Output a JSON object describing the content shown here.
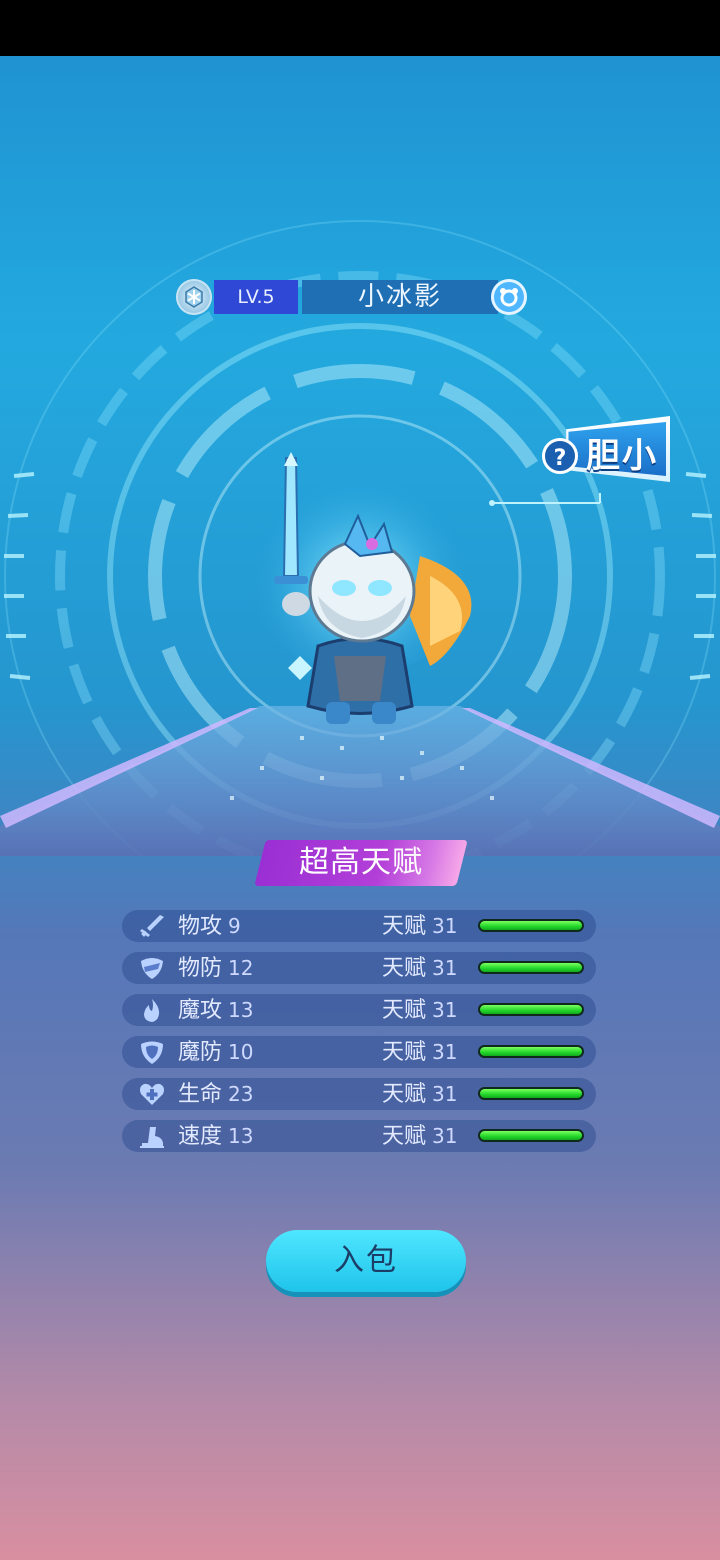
{
  "monster": {
    "level": "LV.5",
    "name": "小冰影",
    "element_icon": "ice-element-icon",
    "gender_icon": "gender-icon"
  },
  "trait": {
    "help_glyph": "?",
    "label": "胆小"
  },
  "talent_banner": "超高天赋",
  "stats": [
    {
      "icon": "sword-icon",
      "name": "物攻",
      "value": "9",
      "talent_label": "天赋",
      "talent_value": "31",
      "talent_fill": 1.0
    },
    {
      "icon": "shield-icon",
      "name": "物防",
      "value": "12",
      "talent_label": "天赋",
      "talent_value": "31",
      "talent_fill": 1.0
    },
    {
      "icon": "flame-icon",
      "name": "魔攻",
      "value": "13",
      "talent_label": "天赋",
      "talent_value": "31",
      "talent_fill": 1.0
    },
    {
      "icon": "magic-shield-icon",
      "name": "魔防",
      "value": "10",
      "talent_label": "天赋",
      "talent_value": "31",
      "talent_fill": 1.0
    },
    {
      "icon": "heart-plus-icon",
      "name": "生命",
      "value": "23",
      "talent_label": "天赋",
      "talent_value": "31",
      "talent_fill": 1.0
    },
    {
      "icon": "boot-icon",
      "name": "速度",
      "value": "13",
      "talent_label": "天赋",
      "talent_value": "31",
      "talent_fill": 1.0
    }
  ],
  "actions": {
    "pack_label": "入包"
  },
  "colors": {
    "level_bg": "#2f49d6",
    "name_bg": "#1e6fb4",
    "talent_bar": "#22d62a",
    "button": "#1fc4ea"
  }
}
